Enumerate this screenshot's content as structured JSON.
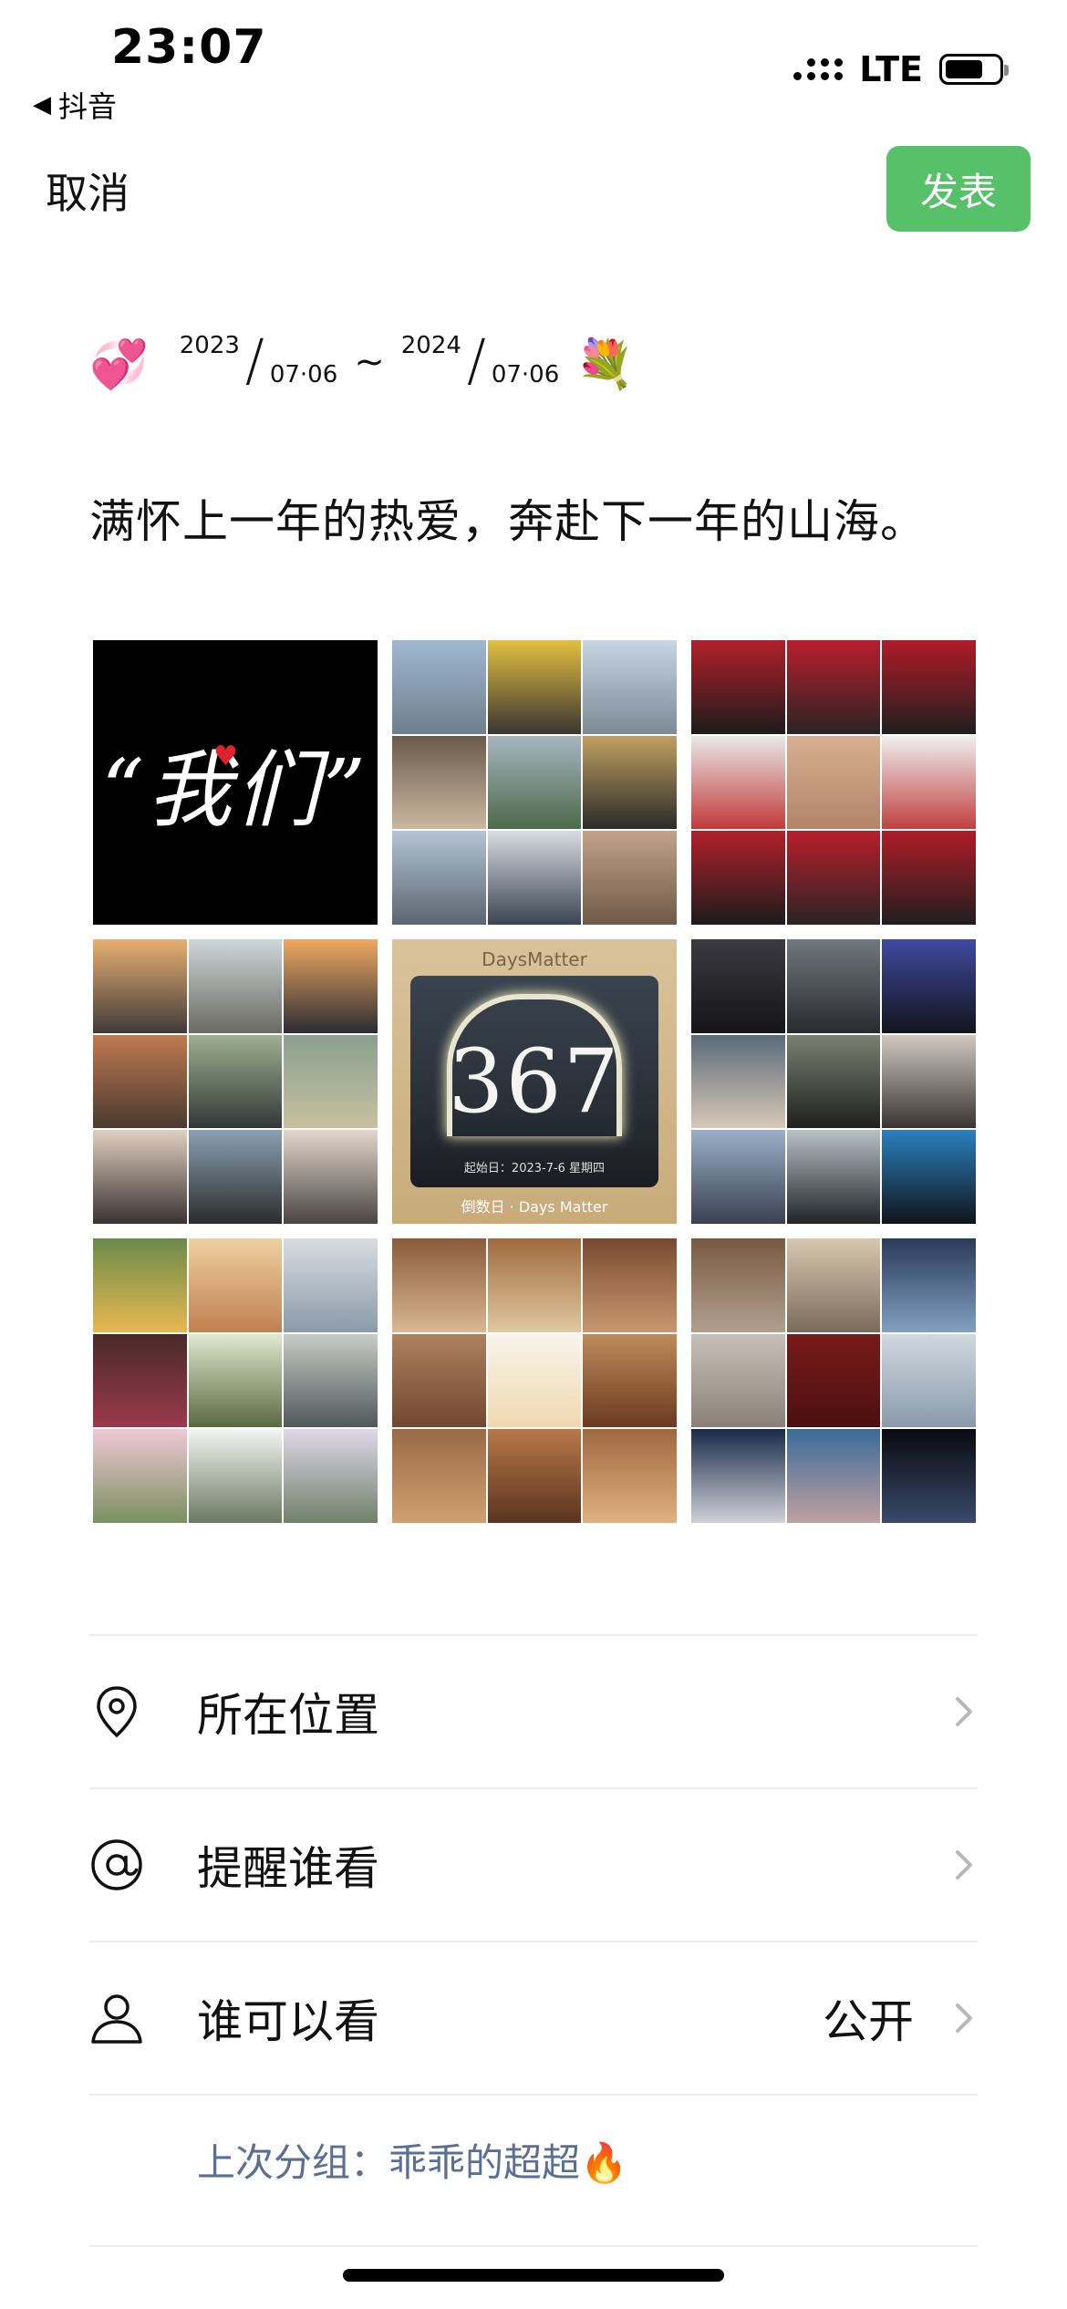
{
  "status_bar": {
    "time": "23:07",
    "back_app": "抖音",
    "network": "LTE",
    "battery_level": 0.72
  },
  "top_bar": {
    "cancel_label": "取消",
    "publish_label": "发表"
  },
  "post": {
    "start_year": "2023",
    "start_date": "07·06",
    "separator": "~",
    "end_year": "2024",
    "end_date": "07·06",
    "text": "满怀上一年的热爱，奔赴下一年的山海。"
  },
  "photos": {
    "first_tile_text": "“我们”",
    "days_brand": "DaysMatter",
    "days_number": "367",
    "days_subtitle": "起始日：2023-7-6 星期四",
    "days_footer": "倒数日 · Days Matter"
  },
  "options": {
    "location_label": "所在位置",
    "mention_label": "提醒谁看",
    "visibility_label": "谁可以看",
    "visibility_value": "公开",
    "last_group_prefix": "上次分组：",
    "last_group_name": "乖乖的超超"
  },
  "colors": {
    "publish_green": "#57c169",
    "link_blue_gray": "#5a6f95"
  },
  "icons": {
    "location": "location-pin-icon",
    "mention": "at-sign-icon",
    "visibility": "person-icon",
    "chevron": "chevron-right-icon"
  }
}
